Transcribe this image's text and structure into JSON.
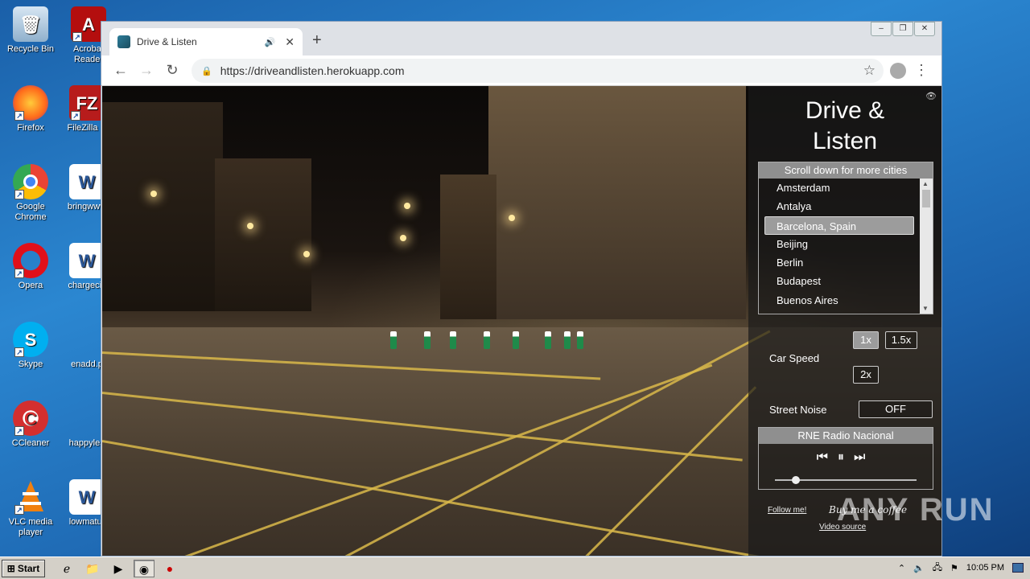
{
  "desktop": {
    "icons": [
      {
        "label": "Recycle Bin",
        "icon": "recycle-bin-icon"
      },
      {
        "label": "Acrobat Reader",
        "icon": "acrobat-icon"
      },
      {
        "label": "Firefox",
        "icon": "firefox-icon"
      },
      {
        "label": "FileZilla C",
        "icon": "filezilla-icon"
      },
      {
        "label": "Google Chrome",
        "icon": "chrome-icon"
      },
      {
        "label": "bringwww",
        "icon": "word-doc-icon"
      },
      {
        "label": "Opera",
        "icon": "opera-icon"
      },
      {
        "label": "chargeciv",
        "icon": "word-doc-icon"
      },
      {
        "label": "Skype",
        "icon": "skype-icon"
      },
      {
        "label": "enadd.p",
        "icon": "file-icon"
      },
      {
        "label": "CCleaner",
        "icon": "ccleaner-icon"
      },
      {
        "label": "happylea",
        "icon": "file-icon"
      },
      {
        "label": "VLC media player",
        "icon": "vlc-icon"
      },
      {
        "label": "lowmatur",
        "icon": "word-doc-icon"
      }
    ]
  },
  "browser": {
    "tab_title": "Drive & Listen",
    "new_tab": "+",
    "url": "https://driveandlisten.herokuapp.com"
  },
  "app": {
    "title_line1": "Drive &",
    "title_line2": "Listen",
    "city_header": "Scroll down for more cities",
    "cities": [
      "Amsterdam",
      "Antalya",
      "Barcelona, Spain",
      "Beijing",
      "Berlin",
      "Budapest",
      "Buenos Aires"
    ],
    "selected_city": "Barcelona, Spain",
    "car_speed_label": "Car Speed",
    "speed_options": [
      "1x",
      "1.5x",
      "2x"
    ],
    "selected_speed": "1x",
    "street_noise_label": "Street Noise",
    "street_noise_value": "OFF",
    "radio_station": "RNE Radio Nacional",
    "volume": 0.15,
    "follow_me": "Follow me!",
    "buy_coffee": "Buy me a coffee",
    "video_source": "Video source"
  },
  "watermark": "ANY RUN",
  "taskbar": {
    "start": "Start",
    "clock": "10:05 PM"
  }
}
